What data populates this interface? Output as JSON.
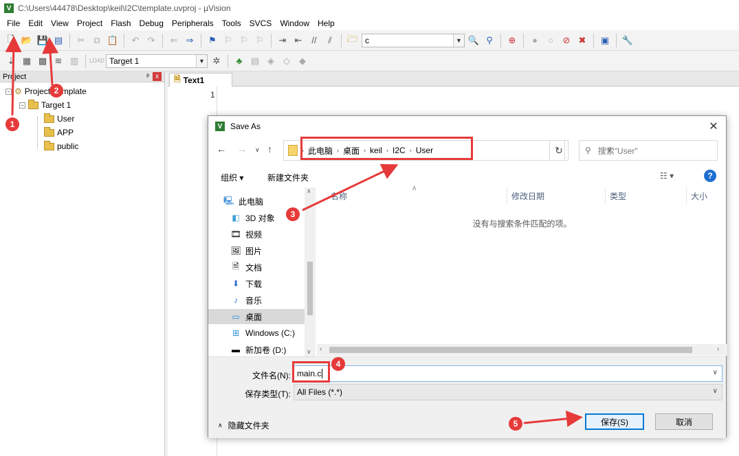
{
  "window": {
    "title": "C:\\Users\\44478\\Desktop\\keil\\I2C\\template.uvproj - µVision",
    "icon_letter": "V"
  },
  "menu": [
    "File",
    "Edit",
    "View",
    "Project",
    "Flash",
    "Debug",
    "Peripherals",
    "Tools",
    "SVCS",
    "Window",
    "Help"
  ],
  "toolbar": {
    "find_text": "c",
    "target_select": "Target 1",
    "load_label": "LOAD"
  },
  "project_panel": {
    "header": "Project",
    "pin_glyph": "ᵖ",
    "close_glyph": "x",
    "tree": {
      "root": "Project: template",
      "target": "Target 1",
      "groups": [
        "User",
        "APP",
        "public"
      ]
    }
  },
  "editor": {
    "tab": "Text1",
    "line_number": "1"
  },
  "dialog": {
    "title": "Save As",
    "close_glyph": "✕",
    "breadcrumb": [
      "此电脑",
      "桌面",
      "keil",
      "I2C",
      "User"
    ],
    "search_placeholder": "搜索\"User\"",
    "organize": "组织 ▾",
    "new_folder": "新建文件夹",
    "nav_items": [
      "此电脑",
      "3D 对象",
      "视频",
      "图片",
      "文档",
      "下载",
      "音乐",
      "桌面",
      "Windows (C:)",
      "新加卷 (D:)"
    ],
    "nav_selected": "桌面",
    "columns": [
      "名称",
      "修改日期",
      "类型",
      "大小"
    ],
    "empty_message": "没有与搜索条件匹配的项。",
    "filename_label": "文件名(N):",
    "filename_value": "main.c",
    "filetype_label": "保存类型(T):",
    "filetype_value": "All Files (*.*)",
    "hide_folders": "隐藏文件夹",
    "save_button": "保存(S)",
    "cancel_button": "取消"
  },
  "annotations": [
    "1",
    "2",
    "3",
    "4",
    "5"
  ],
  "colors": {
    "annotation": "#e63a3a",
    "accent": "#0078d7",
    "help": "#1f6fd1",
    "folder": "#e8c04b"
  }
}
